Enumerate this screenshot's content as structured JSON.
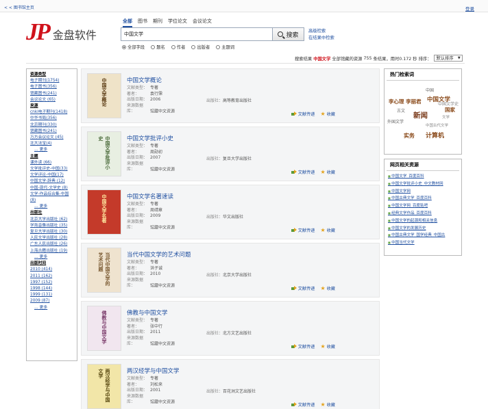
{
  "topbar": {
    "home": "< < 图书馆主页",
    "logout": "登录"
  },
  "logo": {
    "mark": "JP",
    "name": "金盘软件"
  },
  "search": {
    "tabs": [
      {
        "label": "全部",
        "active": true
      },
      {
        "label": "图书",
        "active": false
      },
      {
        "label": "期刊",
        "active": false
      },
      {
        "label": "学位论文",
        "active": false
      },
      {
        "label": "会议论文",
        "active": false
      }
    ],
    "query": "中国文学",
    "button": "搜索",
    "advanced": "高级检索",
    "within": "在结果中检索",
    "fields": [
      {
        "label": "全部字段",
        "checked": true
      },
      {
        "label": "题名",
        "checked": false
      },
      {
        "label": "作者",
        "checked": false
      },
      {
        "label": "出版者",
        "checked": false
      },
      {
        "label": "主题词",
        "checked": false
      }
    ]
  },
  "stats": {
    "prefix": "搜索结果",
    "keyword": "中国文学",
    "middle": "全部馆藏的资源",
    "count": "755",
    "suffix": "条结果，用时0.172 秒",
    "sort_label": "排序：",
    "sort_value": "默认排序"
  },
  "facets": [
    {
      "type": "grp",
      "text": "资源类型"
    },
    {
      "type": "item",
      "text": "电子期刊(1754)"
    },
    {
      "type": "item",
      "text": "电子图书(356)"
    },
    {
      "type": "item",
      "text": "馆藏图书(241)"
    },
    {
      "type": "item",
      "text": "会议论文 (65)"
    },
    {
      "type": "grp",
      "text": "来源"
    },
    {
      "type": "item",
      "text": "cnki电子期刊(1418)"
    },
    {
      "type": "item",
      "text": "中华书局(356)"
    },
    {
      "type": "item",
      "text": "北京期刊(330)"
    },
    {
      "type": "item",
      "text": "馆藏图书(241)"
    },
    {
      "type": "item",
      "text": "万方会议论文 (45)"
    },
    {
      "type": "item",
      "text": "北大法宝(4)"
    },
    {
      "type": "more",
      "text": "… 更多"
    },
    {
      "type": "grp",
      "text": "主题"
    },
    {
      "type": "item",
      "text": "课外读 (66)"
    },
    {
      "type": "item",
      "text": "文学批评史-中国(33)"
    },
    {
      "type": "item",
      "text": "文学评论-中国(17)"
    },
    {
      "type": "item",
      "text": "中国文学-辞典 (12)"
    },
    {
      "type": "item",
      "text": "中国-现代-文学史 (8)"
    },
    {
      "type": "item",
      "text": "文学-作品综合集-中国"
    },
    {
      "type": "item",
      "text": "(8)"
    },
    {
      "type": "more",
      "text": "… 更多"
    },
    {
      "type": "grp",
      "text": "出版社"
    },
    {
      "type": "item",
      "text": "北京大学出版社 (62)"
    },
    {
      "type": "item",
      "text": "学苑音像出版社 (35)"
    },
    {
      "type": "item",
      "text": "复旦大学出版社 (30)"
    },
    {
      "type": "item",
      "text": "人民文学出版社 (28)"
    },
    {
      "type": "item",
      "text": "广东人民出版社 (26)"
    },
    {
      "type": "item",
      "text": "上海古籍出版社 (19)"
    },
    {
      "type": "more",
      "text": "… 更多"
    },
    {
      "type": "grp",
      "text": "出版时间"
    },
    {
      "type": "item",
      "text": "2010 (414)"
    },
    {
      "type": "item",
      "text": "2011 (162)"
    },
    {
      "type": "item",
      "text": "1997 (152)"
    },
    {
      "type": "item",
      "text": "1998 (144)"
    },
    {
      "type": "item",
      "text": "1999 (131)"
    },
    {
      "type": "item",
      "text": "2009 (87)"
    },
    {
      "type": "more",
      "text": "… 更多"
    }
  ],
  "labels": {
    "type": "文献类型：",
    "author": "著者：",
    "year": "出版日期：",
    "source": "来源数据库：",
    "publisher": "出版社：",
    "deliver": "文献传递",
    "collect": "收藏"
  },
  "results": [
    {
      "title": "中国文学概论",
      "type": "专著",
      "author": "袁行霈",
      "year": "2006",
      "source": "馆藏中文资源",
      "publisher": "高等教育出版社",
      "cover_text": "中国文学概论",
      "cover_bg": "#efe3c8",
      "cover_fg": "#5a3a12"
    },
    {
      "title": "中国文学批评小史",
      "type": "专著",
      "author": "周勋初",
      "year": "2007",
      "source": "馆藏中文资源",
      "publisher": "复旦大学出版社",
      "cover_text": "中国文学批评小史",
      "cover_bg": "#e8efe2",
      "cover_fg": "#4a6a3a"
    },
    {
      "title": "中国文学名著速读",
      "type": "专著",
      "author": "周靖章",
      "year": "2009",
      "source": "馆藏中文资源",
      "publisher": "华文出版社",
      "cover_text": "中国文学名著",
      "cover_bg": "#c43a2a",
      "cover_fg": "#ffe8a0"
    },
    {
      "title": "当代中国文学的艺术问题",
      "type": "专著",
      "author": "洪子诚",
      "year": "2010",
      "source": "馆藏中文资源",
      "publisher": "北京大学出版社",
      "cover_text": "当代中国文学的艺术问题",
      "cover_bg": "#efe3cf",
      "cover_fg": "#7a5a32"
    },
    {
      "title": "佛教与中国文学",
      "type": "专著",
      "author": "张中行",
      "year": "2011",
      "source": "馆藏中文资源",
      "publisher": "北方文艺出版社",
      "cover_text": "佛教与中国文学",
      "cover_bg": "#f1e6ef",
      "cover_fg": "#7a3a6a"
    },
    {
      "title": "两汉经学与中国文学",
      "type": "专著",
      "author": "刘松来",
      "year": "2001",
      "source": "馆藏中文资源",
      "publisher": "百花洲文艺出版社",
      "cover_text": "两汉经学与中国文学",
      "cover_bg": "#f2e6a8",
      "cover_fg": "#5a4a12"
    }
  ],
  "hot": {
    "title": "热门检索词",
    "words": [
      {
        "text": "中国",
        "color": "#666666"
      },
      {
        "text": "中国文学",
        "color": "#8a4a1a"
      },
      {
        "text": "李心理 李丽君",
        "color": "#8a4a1a"
      },
      {
        "text": "古文",
        "color": "#666666"
      },
      {
        "text": "新闻",
        "color": "#7a3a1a"
      },
      {
        "text": "外国文学",
        "color": "#666666"
      },
      {
        "text": "国家",
        "color": "#8a4a1a"
      },
      {
        "text": "实务",
        "color": "#8a4a1a"
      },
      {
        "text": "计算机",
        "color": "#8a4a1a"
      },
      {
        "text": "中国文学史",
        "color": "#888888"
      },
      {
        "text": "文学",
        "color": "#888888"
      },
      {
        "text": "中国古代文学",
        "color": "#888888"
      }
    ]
  },
  "related": {
    "title": "网页相关资源",
    "items": [
      "中国文学_百度百科",
      "中国文学批评小史_中文教材网",
      "中国文学网",
      "中国古典文学_百度百科",
      "中国文学网_百度贴吧",
      "经典文学作品_百度百科",
      "中国文学的起源和相关信息",
      "中国文学的发展历史",
      "中国古典文学_国学经典_中国古",
      "中国当代文学"
    ]
  }
}
